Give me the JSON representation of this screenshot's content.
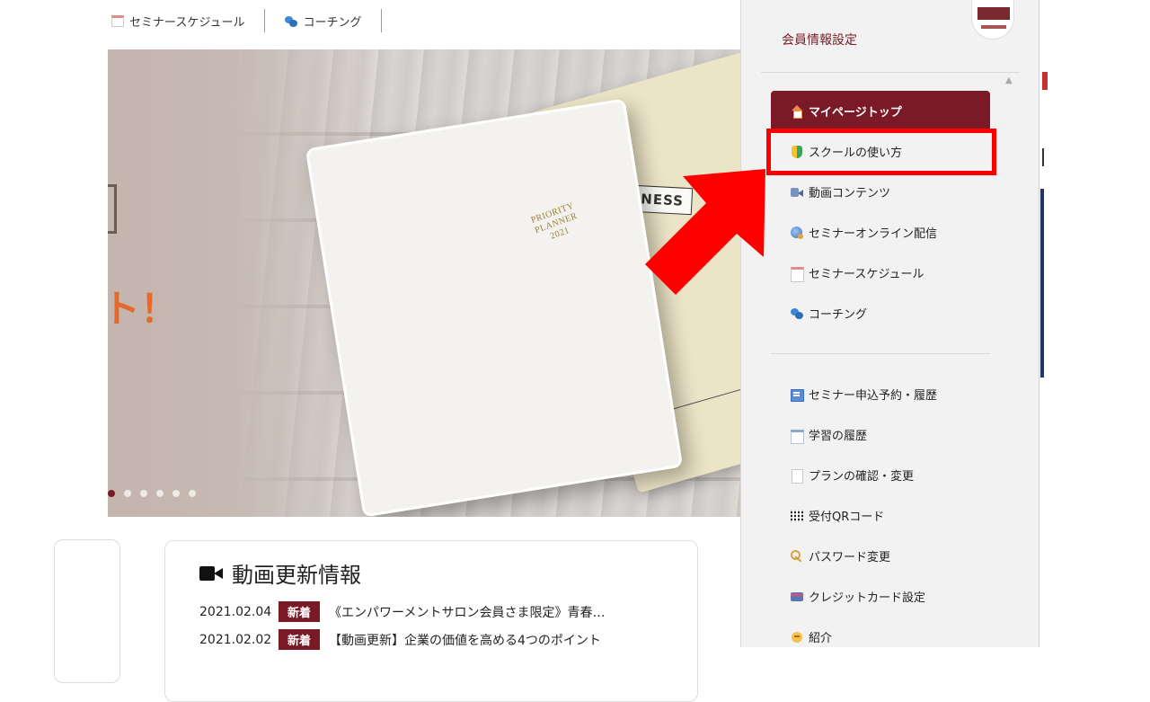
{
  "top_nav": {
    "items": [
      {
        "label": "セミナースケジュール",
        "icon": "calendar-icon"
      },
      {
        "label": "コーチング",
        "icon": "chat-bubble-icon"
      }
    ]
  },
  "hero": {
    "headline_fragment": "ト！",
    "book_front_title": [
      "PRIORITY",
      "PLANNER",
      "2021"
    ],
    "book_back_title": "WARENESS",
    "carousel": {
      "total_slides": 6,
      "active_index": 0
    }
  },
  "news": {
    "title": "動画更新情報",
    "items": [
      {
        "date": "2021.02.04",
        "badge": "新着",
        "text": "《エンパワーメントサロン会員さま限定》青春…"
      },
      {
        "date": "2021.02.02",
        "badge": "新着",
        "text": "【動画更新】企業の価値を高める4つのポイント"
      }
    ]
  },
  "panel": {
    "settings_link": "会員情報設定",
    "menu_group_1": [
      {
        "label": "マイページトップ",
        "icon": "home-icon",
        "active": true
      },
      {
        "label": "スクールの使い方",
        "icon": "beginner-leaf-icon",
        "active": false
      },
      {
        "label": "動画コンテンツ",
        "icon": "video-icon",
        "active": false
      },
      {
        "label": "セミナーオンライン配信",
        "icon": "globe-icon",
        "active": false
      },
      {
        "label": "セミナースケジュール",
        "icon": "calendar-icon",
        "active": false
      },
      {
        "label": "コーチング",
        "icon": "chat-bubble-icon",
        "active": false
      }
    ],
    "menu_group_2": [
      {
        "label": "セミナー申込予約・履歴",
        "icon": "form-icon"
      },
      {
        "label": "学習の履歴",
        "icon": "history-icon"
      },
      {
        "label": "プランの確認・変更",
        "icon": "document-icon"
      },
      {
        "label": "受付QRコード",
        "icon": "qr-code-icon"
      },
      {
        "label": "パスワード変更",
        "icon": "key-icon"
      },
      {
        "label": "クレジットカード設定",
        "icon": "credit-card-icon"
      },
      {
        "label": "紹介",
        "icon": "introduction-icon"
      }
    ]
  },
  "annotation": {
    "highlight_target": "スクールの使い方",
    "color": "#ff0000"
  },
  "colors": {
    "brand": "#7b1a27",
    "accent_orange": "#e4692a"
  }
}
